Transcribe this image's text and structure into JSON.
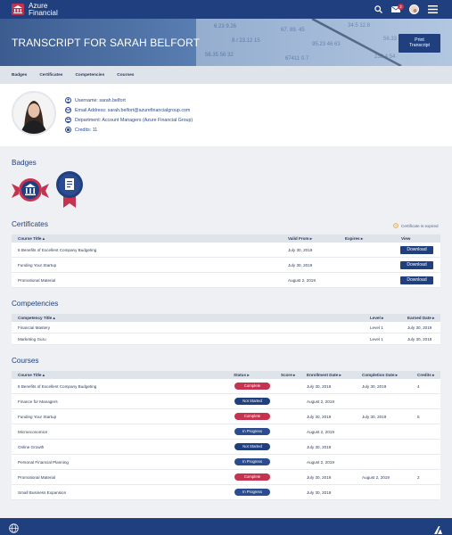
{
  "header": {
    "brand_line1": "Azure",
    "brand_line2": "Financial",
    "mail_count": "2",
    "icons": [
      "bank-icon",
      "search-icon",
      "mail-icon",
      "avatar",
      "menu-icon"
    ]
  },
  "hero": {
    "title": "TRANSCRIPT FOR SARAH BELFORT",
    "print_line1": "Print",
    "print_line2": "Transcript"
  },
  "subnav": [
    "Badges",
    "Certificates",
    "Competencies",
    "Courses"
  ],
  "profile": {
    "username": "Username: sarah.belfort",
    "email": "Email Address: sarah.belfort@azurefinancialgroup.com",
    "department": "Department: Account Managers (Azure Financial Group)",
    "credits": "Credits: 11"
  },
  "badges": {
    "title": "Badges"
  },
  "certificates": {
    "title": "Certificates",
    "expired_note": "Certificate is expired",
    "headers": {
      "course_title": "Course Title ▴",
      "valid_from": "Valid From ▸",
      "expires": "Expires ▸",
      "view": "View"
    },
    "rows": [
      {
        "title": "6 Benefits of Excellent Company Budgeting",
        "valid_from": "July 30, 2019",
        "action": "Download"
      },
      {
        "title": "Funding Your Startup",
        "valid_from": "July 30, 2019",
        "action": "Download"
      },
      {
        "title": "Promotional Material",
        "valid_from": "August 2, 2019",
        "action": "Download"
      }
    ]
  },
  "competencies": {
    "title": "Competencies",
    "headers": {
      "title": "Competency Title ▴",
      "level": "Level ▸",
      "earned": "Earned Date ▸"
    },
    "rows": [
      {
        "title": "Financial Mastery",
        "level": "Level 1",
        "earned": "July 30, 2019"
      },
      {
        "title": "Marketing Guru",
        "level": "Level 1",
        "earned": "July 30, 2019"
      }
    ]
  },
  "courses": {
    "title": "Courses",
    "headers": {
      "title": "Course Title ▴",
      "status": "Status ▸",
      "score": "Score ▸",
      "enrollment": "Enrollment Date ▸",
      "completion": "Completion Date ▸",
      "credits": "Credits ▸"
    },
    "rows": [
      {
        "title": "6 Benefits of Excellent Company Budgeting",
        "status": "Complete",
        "enrollment": "July 30, 2019",
        "completion": "July 30, 2019",
        "credits": "4"
      },
      {
        "title": "Finance for Managers",
        "status": "Not Started",
        "enrollment": "August 2, 2019",
        "completion": "",
        "credits": ""
      },
      {
        "title": "Funding Your Startup",
        "status": "Complete",
        "enrollment": "July 30, 2019",
        "completion": "July 30, 2019",
        "credits": "5"
      },
      {
        "title": "Microeconomics",
        "status": "In Progress",
        "enrollment": "August 2, 2019",
        "completion": "",
        "credits": ""
      },
      {
        "title": "Online Growth",
        "status": "Not Started",
        "enrollment": "July 30, 2019",
        "completion": "",
        "credits": ""
      },
      {
        "title": "Personal Financial Planning",
        "status": "In Progress",
        "enrollment": "August 2, 2019",
        "completion": "",
        "credits": ""
      },
      {
        "title": "Promotional Material",
        "status": "Complete",
        "enrollment": "July 30, 2019",
        "completion": "August 2, 2019",
        "credits": "2"
      },
      {
        "title": "Small Business Expansion",
        "status": "In Progress",
        "enrollment": "July 30, 2019",
        "completion": "",
        "credits": ""
      }
    ]
  },
  "colors": {
    "brand": "#1f3f7f",
    "accent": "#c4334f",
    "complete": "#c4334f",
    "not_started": "#1f3f7f",
    "in_progress": "#2b4c90"
  }
}
